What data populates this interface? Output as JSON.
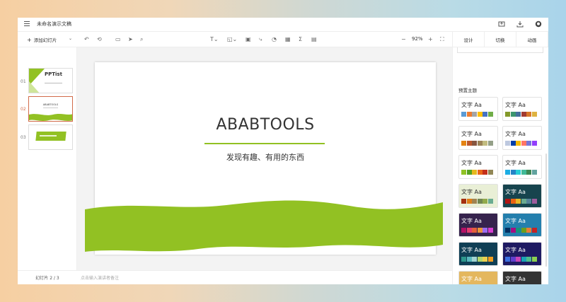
{
  "title_bar": {
    "doc_title": "未命名演示文稿",
    "icons": [
      "menu-icon",
      "export-icon",
      "download-icon",
      "github-icon"
    ]
  },
  "toolbar": {
    "add_slide_label": "添加幻灯片",
    "zoom": "92%",
    "tools": [
      "undo-icon",
      "redo-icon",
      "comment-icon",
      "select-icon",
      "search-icon",
      "text-icon",
      "shape-icon",
      "image-icon",
      "line-icon",
      "chart-icon",
      "table-icon",
      "formula-icon",
      "media-icon",
      "zoom-out-icon",
      "zoom-in-icon",
      "fullscreen-icon"
    ]
  },
  "right_tabs": [
    "设计",
    "切换",
    "动画"
  ],
  "thumbnails": [
    {
      "num": "01",
      "title": "PPTist"
    },
    {
      "num": "02",
      "title": "ABABTOOLS"
    },
    {
      "num": "03",
      "title": ""
    }
  ],
  "footer": {
    "slide_counter": "幻灯片 2 / 3",
    "notes_placeholder": "点击输入演讲者备注"
  },
  "slide": {
    "title": "ABABTOOLS",
    "subtitle": "发现有趣、有用的东西",
    "accent": "#92c123"
  },
  "themes_section": {
    "title": "预置主题",
    "label": "文字 Aa",
    "themes": [
      {
        "bg": "#ffffff",
        "fg": "#333333",
        "colors": [
          "#5b9bd5",
          "#ed7d31",
          "#a5a5a5",
          "#ffc000",
          "#4472c4",
          "#70ad47"
        ]
      },
      {
        "bg": "#ffffff",
        "fg": "#333333",
        "colors": [
          "#83992a",
          "#3c9670",
          "#44709d",
          "#a23b32",
          "#d87728",
          "#deb340"
        ]
      },
      {
        "bg": "#ffffff",
        "fg": "#333333",
        "colors": [
          "#e48312",
          "#bd582c",
          "#865640",
          "#9b8357",
          "#c2bc80",
          "#94a088"
        ]
      },
      {
        "bg": "#ffffff",
        "fg": "#333333",
        "colors": [
          "#bdc8df",
          "#003fa9",
          "#f5ba00",
          "#ff7567",
          "#7676d9",
          "#923ffc"
        ]
      },
      {
        "bg": "#ffffff",
        "fg": "#333333",
        "colors": [
          "#90c225",
          "#54a121",
          "#e6b91e",
          "#e86618",
          "#c42f19",
          "#918756"
        ]
      },
      {
        "bg": "#ffffff",
        "fg": "#333333",
        "colors": [
          "#1cade4",
          "#2683c6",
          "#27ced7",
          "#42ba97",
          "#3e8853",
          "#62a39f"
        ]
      },
      {
        "bg": "#e9efd6",
        "fg": "#333333",
        "colors": [
          "#a5300f",
          "#de7e18",
          "#9f8351",
          "#728653",
          "#92aa4c",
          "#6aac91"
        ]
      },
      {
        "bg": "#17444e",
        "fg": "#ffffff",
        "colors": [
          "#b01513",
          "#ea6312",
          "#e6b729",
          "#6bab90",
          "#55839a",
          "#9e5d9d"
        ]
      },
      {
        "bg": "#36234d",
        "fg": "#ffffff",
        "colors": [
          "#b31166",
          "#e33d6f",
          "#e45f3c",
          "#e9943a",
          "#9b6bf2",
          "#d53dd0"
        ]
      },
      {
        "bg": "#247fad",
        "fg": "#ffffff",
        "colors": [
          "#052f61",
          "#a50e82",
          "#14967c",
          "#6a9e1f",
          "#e87d37",
          "#c62324"
        ]
      },
      {
        "bg": "#103f55",
        "fg": "#ffffff",
        "colors": [
          "#2d978c",
          "#59b8bd",
          "#a2d4d2",
          "#b3d56a",
          "#ecd04f",
          "#f29d1f"
        ]
      },
      {
        "bg": "#1e1a62",
        "fg": "#ffffff",
        "colors": [
          "#3b6fe0",
          "#5f3ecc",
          "#c646b6",
          "#19a1b6",
          "#4fbc8c",
          "#8bcf51"
        ]
      },
      {
        "bg": "#e4b75e",
        "fg": "#ffffff",
        "colors": [
          "#fbbe36",
          "#d4a64e",
          "#9c6a6a",
          "#ec9f4d",
          "#e96e37",
          "#c4a78a"
        ]
      },
      {
        "bg": "#333333",
        "fg": "#ffffff",
        "colors": [
          "#e2e1d2",
          "#444ea6",
          "#f6a621",
          "#ee7c3e",
          "#9b5bd6",
          "#2ba9e1"
        ]
      }
    ]
  }
}
